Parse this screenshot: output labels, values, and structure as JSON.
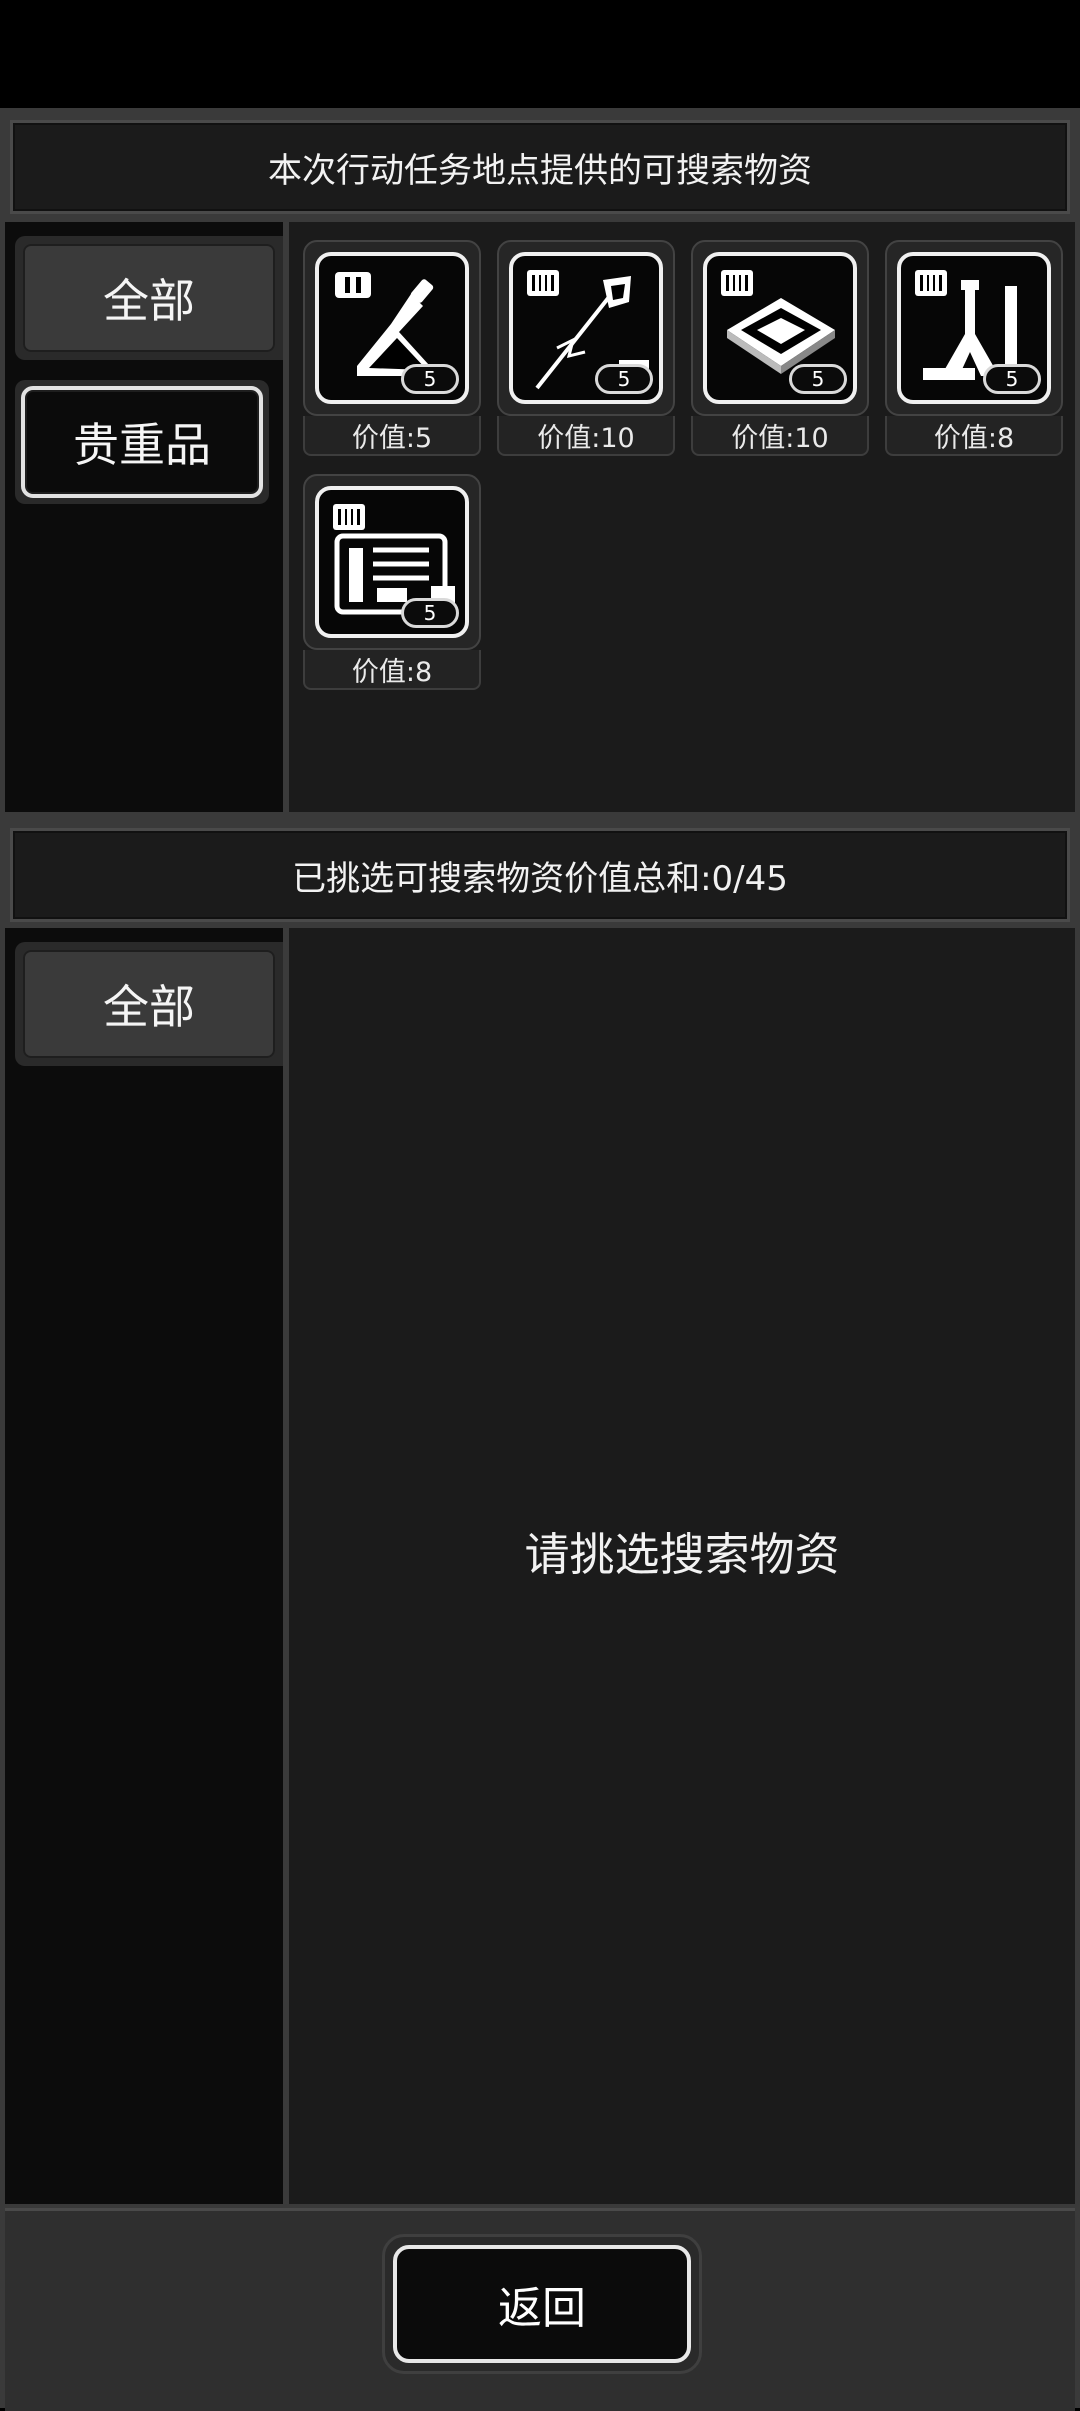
{
  "top": {
    "title": "本次行动任务地点提供的可搜索物资",
    "tabs": [
      {
        "label": "全部",
        "state": "default"
      },
      {
        "label": "贵重品",
        "state": "selected"
      }
    ],
    "items": [
      {
        "icon": "flask-icon",
        "tier": "I",
        "count": "5",
        "value_label": "价值:5"
      },
      {
        "icon": "syringe-icon",
        "tier": "III",
        "count": "5",
        "value_label": "价值:10"
      },
      {
        "icon": "chip-icon",
        "tier": "III",
        "count": "5",
        "value_label": "价值:10"
      },
      {
        "icon": "lab-stand-icon",
        "tier": "III",
        "count": "5",
        "value_label": "价值:8"
      },
      {
        "icon": "circuit-device-icon",
        "tier": "III",
        "count": "5",
        "value_label": "价值:8"
      }
    ]
  },
  "bottom": {
    "summary": "已挑选可搜索物资价值总和:0/45",
    "tabs": [
      {
        "label": "全部",
        "state": "default"
      }
    ],
    "empty_text": "请挑选搜索物资"
  },
  "footer": {
    "back_label": "返回"
  }
}
